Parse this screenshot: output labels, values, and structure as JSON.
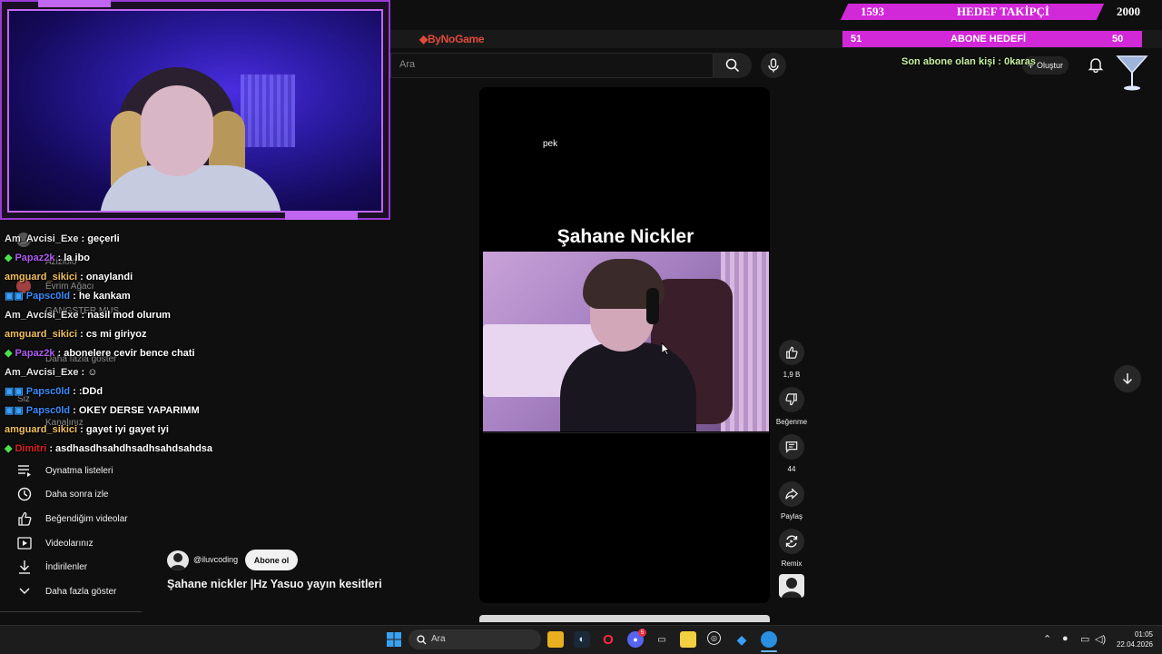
{
  "overlay": {
    "follower_goal": {
      "current": "1593",
      "label": "HEDEF TAKİPÇİ",
      "target": "2000"
    },
    "sub_goal": {
      "current": "51",
      "label": "ABONE HEDEFİ",
      "target": "50"
    },
    "last_sub": "Son abone olan kişi : 0karas",
    "logo": "ByNoGame"
  },
  "chat": [
    {
      "badge": "",
      "user": "Am_Avcisi_Exe",
      "color": "#e6e6e6",
      "msg": ": geçerli"
    },
    {
      "badge": "◆",
      "badge_color": "#4ce04c",
      "user": "Papaz2k",
      "color": "#b05cf0",
      "msg": ": la ibo"
    },
    {
      "badge": "",
      "user": "amguard_sikici",
      "color": "#f0c060",
      "msg": ": onaylandi"
    },
    {
      "badge": "▣▣",
      "badge_color": "#3aa0ff",
      "user": "Papsc0ld",
      "color": "#3a8cff",
      "msg": ": he kankam"
    },
    {
      "badge": "",
      "user": "Am_Avcisi_Exe",
      "color": "#e6e6e6",
      "msg": ": nasil mod olurum"
    },
    {
      "badge": "",
      "user": "amguard_sikici",
      "color": "#f0c060",
      "msg": ": cs mi giriyoz"
    },
    {
      "badge": "◆",
      "badge_color": "#4ce04c",
      "user": "Papaz2k",
      "color": "#b05cf0",
      "msg": ": abonelere cevir bence chati"
    },
    {
      "badge": "",
      "user": "Am_Avcisi_Exe",
      "color": "#e6e6e6",
      "msg": ": ☺"
    },
    {
      "badge": "▣▣",
      "badge_color": "#3aa0ff",
      "user": "Papsc0ld",
      "color": "#3a8cff",
      "msg": ": :DDd"
    },
    {
      "badge": "▣▣",
      "badge_color": "#3aa0ff",
      "user": "Papsc0ld",
      "color": "#3a8cff",
      "msg": ": OKEY DERSE YAPARIMM"
    },
    {
      "badge": "",
      "user": "amguard_sikici",
      "color": "#f0c060",
      "msg": ": gayet iyi gayet iyi"
    },
    {
      "badge": "◆",
      "badge_color": "#4ce04c",
      "user": "Dimitri",
      "color": "#e02020",
      "msg": ": asdhasdhsahdhsadhsahdsahdsa"
    }
  ],
  "yt": {
    "search_placeholder": "Ara",
    "create_label": "Oluştur",
    "ghost_items": [
      "Aziziolo",
      "Evrim Ağacı",
      "GANGSTER MUS",
      "Daha fazla göster",
      "Siz",
      "Kanalınız"
    ],
    "sidebar": [
      {
        "label": "Oynatma listeleri",
        "icon": "playlist-icon"
      },
      {
        "label": "Daha sonra izle",
        "icon": "clock-icon"
      },
      {
        "label": "Beğendiğim videolar",
        "icon": "thumb-up-icon"
      },
      {
        "label": "Videolarınız",
        "icon": "video-icon"
      },
      {
        "label": "İndirilenler",
        "icon": "download-icon"
      },
      {
        "label": "Daha fazla göster",
        "icon": "chevron-down-icon"
      }
    ],
    "short": {
      "caption_small": "pek",
      "title": "Şahane Nickler",
      "likes": "1,9 B",
      "dislike_label": "Beğenme",
      "comments": "44",
      "share_label": "Paylaş",
      "remix_label": "Remix"
    },
    "channel": "@iluvcoding",
    "subscribe_label": "Abone ol",
    "video_title": "Şahane nickler |Hz Yasuo yayın kesitleri"
  },
  "taskbar": {
    "search_placeholder": "Ara",
    "time": "01:05",
    "date": "22.04.2026",
    "discord_badge": "5"
  }
}
